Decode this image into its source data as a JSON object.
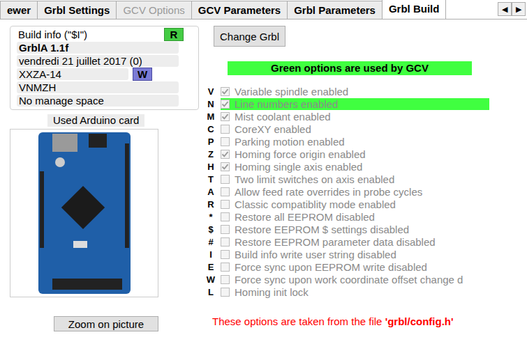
{
  "tabs": [
    {
      "label": "ewer",
      "selected": false,
      "disabled": false
    },
    {
      "label": "Grbl Settings",
      "selected": false,
      "disabled": false
    },
    {
      "label": "GCV Options",
      "selected": false,
      "disabled": true
    },
    {
      "label": "GCV Parameters",
      "selected": false,
      "disabled": false
    },
    {
      "label": "Grbl Parameters",
      "selected": false,
      "disabled": false
    },
    {
      "label": "Grbl Build",
      "selected": true,
      "disabled": false
    }
  ],
  "tab_nav": {
    "prev": "◀",
    "next": "▶"
  },
  "build_info": {
    "title": "Build info (\"$I\")",
    "refresh_button": "R",
    "fields": [
      {
        "value": "GrblA 1.1f",
        "bold": true
      },
      {
        "value": "vendredi 21 juillet 2017 (0)",
        "bold": false
      },
      {
        "value": "XXZA-14",
        "bold": false,
        "button": "W"
      },
      {
        "value": "VNMZH",
        "bold": false
      },
      {
        "value": "No manage space",
        "bold": false
      }
    ]
  },
  "card": {
    "label": "Used Arduino card",
    "zoom_button": "Zoom on picture"
  },
  "change_button": "Change Grbl",
  "banner": "Green options are used by GCV",
  "options": [
    {
      "letter": "V",
      "label": "Variable spindle enabled",
      "checked": true,
      "highlighted": false
    },
    {
      "letter": "N",
      "label": "Line numbers enabled",
      "checked": true,
      "highlighted": true
    },
    {
      "letter": "M",
      "label": "Mist coolant enabled",
      "checked": true,
      "highlighted": false
    },
    {
      "letter": "C",
      "label": "CoreXY enabled",
      "checked": false,
      "highlighted": false
    },
    {
      "letter": "P",
      "label": "Parking motion enabled",
      "checked": false,
      "highlighted": false
    },
    {
      "letter": "Z",
      "label": "Homing force origin enabled",
      "checked": true,
      "highlighted": false
    },
    {
      "letter": "H",
      "label": "Homing single axis enabled",
      "checked": true,
      "highlighted": false
    },
    {
      "letter": "T",
      "label": "Two limit switches on axis enabled",
      "checked": false,
      "highlighted": false
    },
    {
      "letter": "A",
      "label": "Allow feed rate overrides in probe cycles",
      "checked": false,
      "highlighted": false
    },
    {
      "letter": "R",
      "label": "Classic compatiblity mode enabled",
      "checked": false,
      "highlighted": false
    },
    {
      "letter": "*",
      "label": "Restore all EEPROM disabled",
      "checked": false,
      "highlighted": false
    },
    {
      "letter": "$",
      "label": "Restore EEPROM $ settings disabled",
      "checked": false,
      "highlighted": false
    },
    {
      "letter": "#",
      "label": "Restore EEPROM parameter data disabled",
      "checked": false,
      "highlighted": false
    },
    {
      "letter": "I",
      "label": "Build info write user string disabled",
      "checked": false,
      "highlighted": false
    },
    {
      "letter": "E",
      "label": "Force sync upon EEPROM write disabled",
      "checked": false,
      "highlighted": false
    },
    {
      "letter": "W",
      "label": "Force sync upon work coordinate offset change d",
      "checked": false,
      "highlighted": false
    },
    {
      "letter": "L",
      "label": "Homing init lock",
      "checked": false,
      "highlighted": false
    }
  ],
  "footer": {
    "text": "These options are taken from the file ",
    "file": "'grbl/config.h'"
  }
}
